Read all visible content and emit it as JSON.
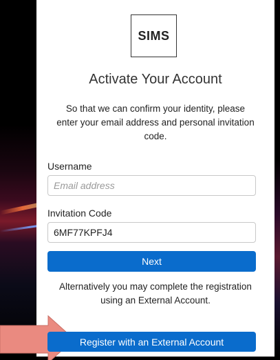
{
  "header": {
    "logo_text": "SIMS"
  },
  "main": {
    "title": "Activate Your Account",
    "intro": "So that we can confirm your identity, please enter your email address and personal invitation code.",
    "username": {
      "label": "Username",
      "placeholder": "Email address",
      "value": ""
    },
    "invitation": {
      "label": "Invitation Code",
      "value": "6MF77KPFJ4"
    },
    "next_label": "Next",
    "alternative_text": "Alternatively you may complete the registration using an External Account.",
    "external_label": "Register with an External Account"
  },
  "colors": {
    "primary_button": "#0a6ccc",
    "annotation_arrow": "#ea8a80"
  },
  "icons": {
    "annotation": "arrow-right-icon"
  }
}
